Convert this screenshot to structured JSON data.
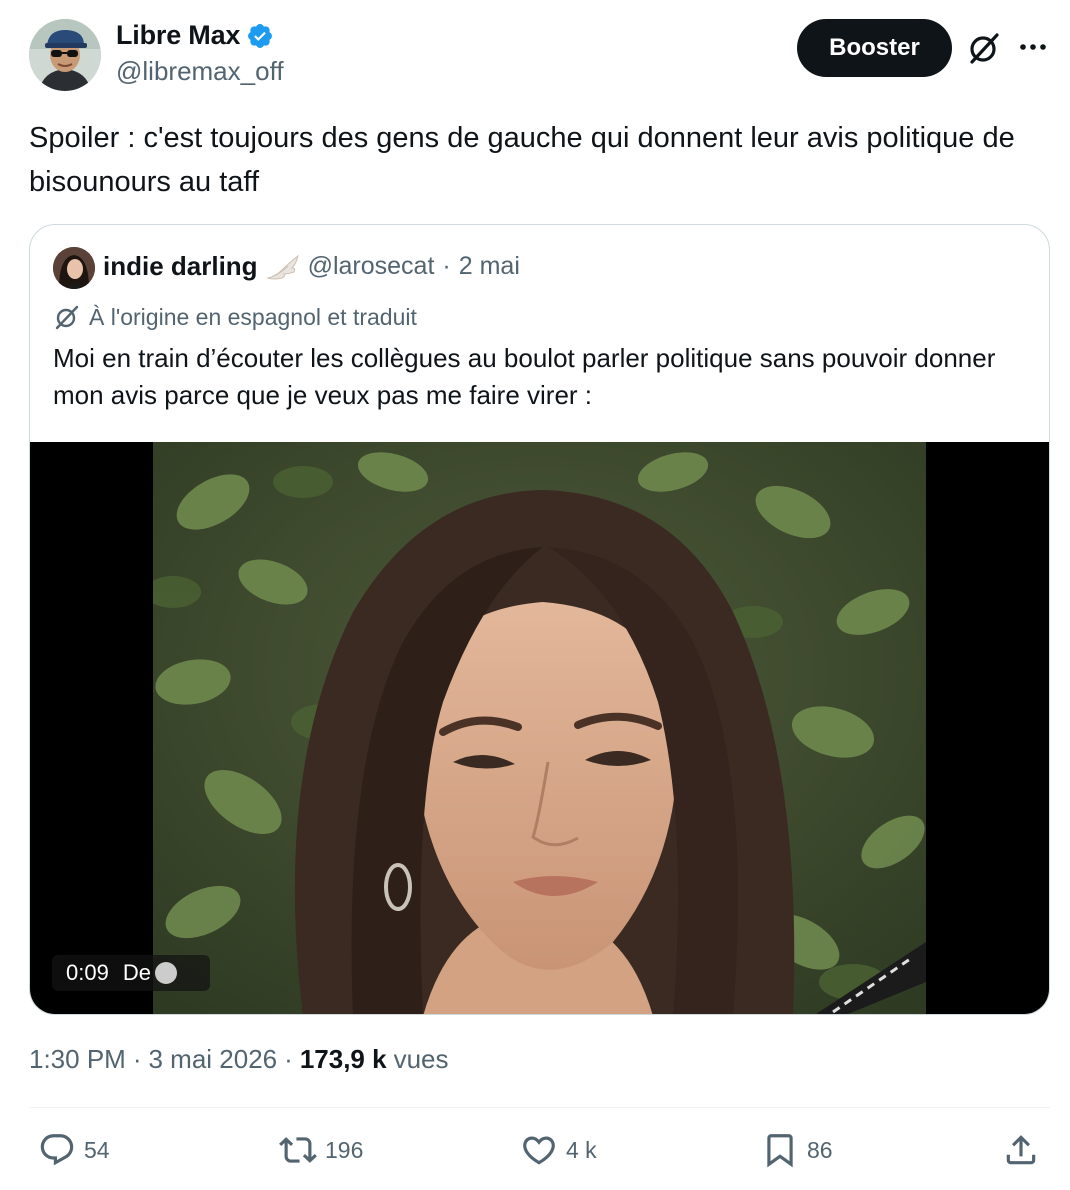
{
  "author": {
    "display_name": "Libre Max",
    "handle": "@libremax_off",
    "verified": true
  },
  "header": {
    "boost_label": "Booster",
    "grok_icon": "grok-icon",
    "more_icon": "more-icon"
  },
  "tweet": {
    "text": "Spoiler : c'est toujours des gens de gauche qui donnent leur avis politique de bisounours au taff"
  },
  "quote": {
    "display_name": "indie darling",
    "handle": "@larosecat",
    "separator": "·",
    "date": "2 mai",
    "translation_note": "À l'origine en espagnol et traduit",
    "text": "Moi en train d’écouter les collègues au boulot parler politique sans pouvoir donner mon avis parce que je veux pas me faire virer :",
    "media": {
      "duration": "0:09",
      "by_label": "De"
    }
  },
  "meta": {
    "time": "1:30 PM",
    "sep1": "·",
    "date": "3 mai 2026",
    "sep2": "·",
    "views_count": "173,9 k",
    "views_label": "vues"
  },
  "actions": {
    "replies": "54",
    "reposts": "196",
    "likes": "4 k",
    "bookmarks": "86"
  },
  "colors": {
    "text": "#0f1419",
    "secondary": "#536471",
    "verified": "#1d9bf0",
    "border": "#cfd9de"
  }
}
